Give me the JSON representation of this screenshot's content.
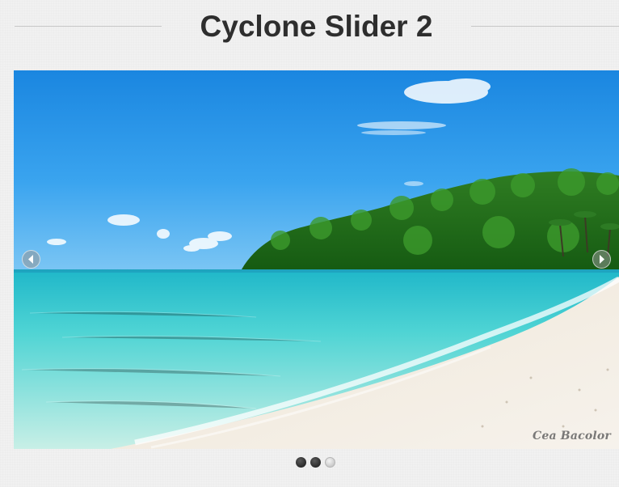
{
  "header": {
    "title": "Cyclone Slider 2"
  },
  "slider": {
    "prev_icon": "chevron-left-icon",
    "next_icon": "chevron-right-icon",
    "photo_credit": "Cea Bacolor",
    "slides_total": 3,
    "pager": [
      {
        "state": "dark"
      },
      {
        "state": "dark"
      },
      {
        "state": "light"
      }
    ]
  },
  "colors": {
    "background": "#f1f1f1",
    "title": "#2e2e2e",
    "pager_dark": "#2a2a2a",
    "pager_light": "#d0d0d0"
  }
}
